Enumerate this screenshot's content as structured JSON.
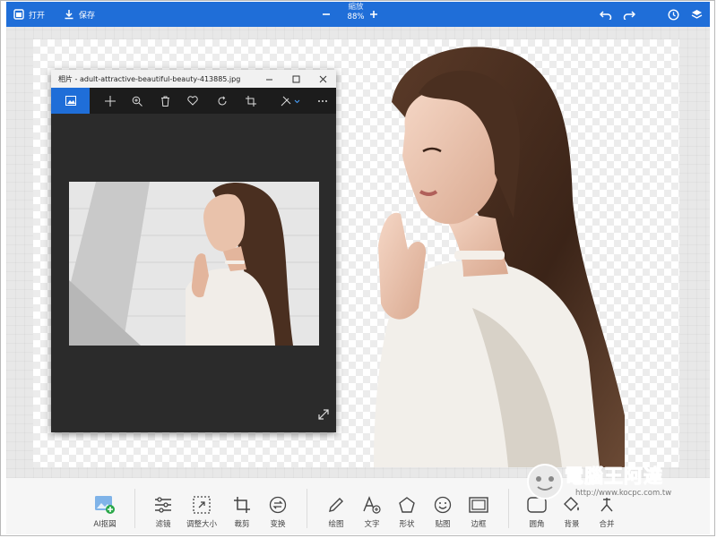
{
  "topbar": {
    "open_label": "打开",
    "save_label": "保存",
    "zoom_label": "縮放",
    "zoom_value": "88%"
  },
  "photos_window": {
    "title": "相片 - adult-attractive-beautiful-beauty-413885.jpg",
    "tools": [
      "photo-icon",
      "add-icon",
      "zoom-icon",
      "delete-icon",
      "favorite-icon",
      "rotate-icon",
      "crop-icon",
      "edit-icon",
      "more-icon"
    ]
  },
  "toolbar": {
    "ai_cutout": "AI抠図",
    "filter": "滤镜",
    "resize": "调整大小",
    "crop": "裁剪",
    "transform": "变换",
    "draw": "绘图",
    "text": "文字",
    "shape": "形状",
    "sticker": "贴图",
    "border": "边框",
    "rounded_corner": "圆角",
    "background": "背景",
    "merge": "合并"
  },
  "watermark": {
    "title": "電腦王阿達",
    "url": "http://www.kocpc.com.tw"
  },
  "colors": {
    "accent": "#1f6ed8",
    "photos_bg": "#2b2b2b"
  }
}
